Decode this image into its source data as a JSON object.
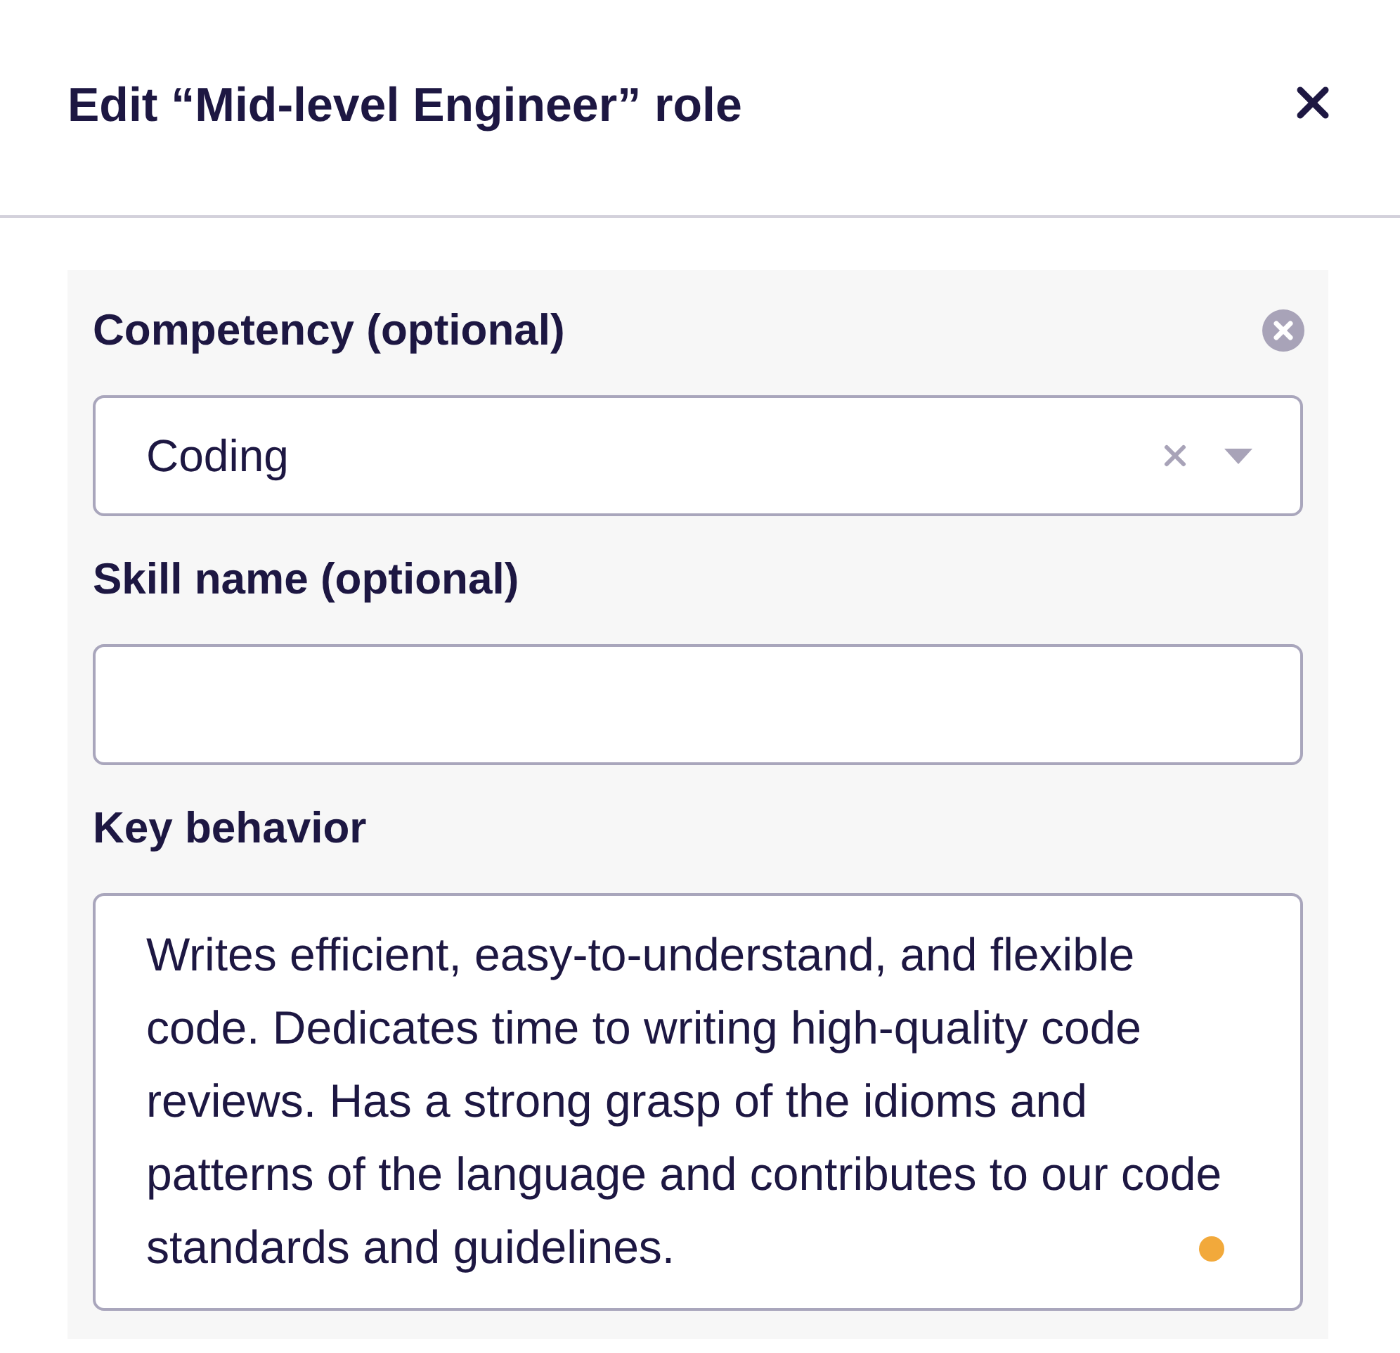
{
  "dialog": {
    "title": "Edit “Mid-level Engineer” role"
  },
  "fields": [
    {
      "kind": "select",
      "label": "Competency (optional)",
      "removable": true,
      "value": "Coding",
      "clearable": true
    },
    {
      "kind": "input",
      "label": "Skill name (optional)"
    },
    {
      "kind": "textarea",
      "label": "Key behavior",
      "value": "Writes efficient, easy-to-understand, and flexible code. Dedicates time to writing high-quality code reviews. Has a strong grasp of the idioms and patterns of the language and contributes to our code standards and guidelines.",
      "status_dot": true
    }
  ]
}
